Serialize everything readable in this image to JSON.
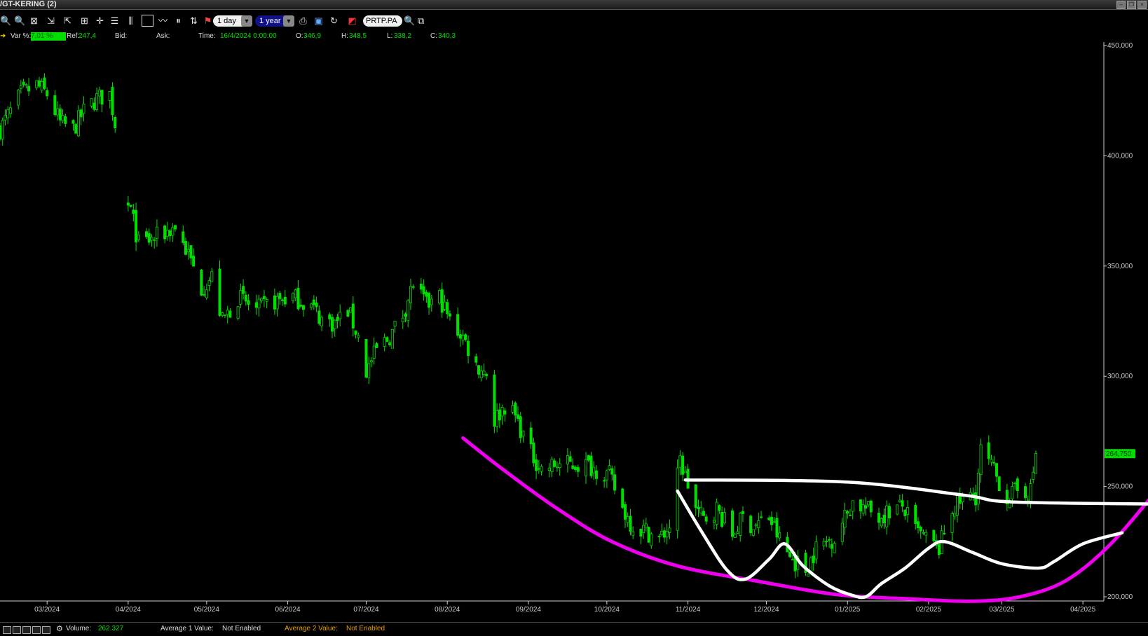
{
  "window": {
    "title": "/GT-KERING (2)"
  },
  "toolbar": {
    "interval": "1 day",
    "range": "1 year",
    "symbol": "PRTP.PA",
    "icons": [
      "zoom-in-icon",
      "zoom-out-icon",
      "zoom-fit-icon",
      "zoom-x-in-icon",
      "zoom-x-out-icon",
      "zoom-all-icon",
      "crosshair-icon",
      "list-icon",
      "bars-icon",
      "window-icon",
      "line-chart-icon",
      "candles-icon",
      "signals-icon",
      "flag-icon",
      "print-icon",
      "save-icon",
      "refresh-icon",
      "color-icon",
      "search-icon",
      "windows-icon"
    ]
  },
  "quote": {
    "var_label": "Var %:",
    "var_value": "7,01 %",
    "ref_label": "Ref:",
    "ref_value": "247,4",
    "bid_label": "Bid:",
    "ask_label": "Ask:",
    "time_label": "Time:",
    "time_value": "16/4/2024 0:00:00",
    "open_label": "O:",
    "open_value": "346,9",
    "high_label": "H:",
    "high_value": "348,5",
    "low_label": "L:",
    "low_value": "338,2",
    "close_label": "C:",
    "close_value": "340,3"
  },
  "status": {
    "volume_label": "Volume:",
    "volume_value": "262.327",
    "avg1_label": "Average 1 Value:",
    "avg1_value": "Not Enabled",
    "avg2_label": "Average 2 Value:",
    "avg2_value": "Not Enabled"
  },
  "colors": {
    "up": "#00e000",
    "background": "#000000",
    "magenta": "#ee00ee",
    "annotation": "#ffffff",
    "avg2": "#e6a000"
  },
  "chart_data": {
    "type": "candlestick",
    "x_start": "2024-02-12",
    "x_end": "2025-04-09",
    "x_ticks": [
      "03/2024",
      "04/2024",
      "05/2024",
      "06/2024",
      "07/2024",
      "08/2024",
      "09/2024",
      "10/2024",
      "11/2024",
      "12/2024",
      "01/2025",
      "02/2025",
      "03/2025",
      "04/2025"
    ],
    "x_tick_dates": [
      "2024-03-01",
      "2024-04-01",
      "2024-05-01",
      "2024-06-01",
      "2024-07-01",
      "2024-08-01",
      "2024-09-01",
      "2024-10-01",
      "2024-11-01",
      "2024-12-01",
      "2025-01-01",
      "2025-02-01",
      "2025-03-01",
      "2025-04-01"
    ],
    "y_ticks": [
      "200,000",
      "250,000",
      "300,000",
      "350,000",
      "400,000",
      "450,000"
    ],
    "ylim": [
      200,
      450
    ],
    "last_price_label": "264,750",
    "last_price": 264.75,
    "price_path": [
      [
        "2024-02-12",
        412
      ],
      [
        "2024-02-16",
        420
      ],
      [
        "2024-02-20",
        428
      ],
      [
        "2024-02-26",
        432
      ],
      [
        "2024-03-01",
        428
      ],
      [
        "2024-03-06",
        415
      ],
      [
        "2024-03-11",
        412
      ],
      [
        "2024-03-15",
        420
      ],
      [
        "2024-03-20",
        426
      ],
      [
        "2024-03-25",
        428
      ],
      [
        "2024-04-02",
        375
      ],
      [
        "2024-04-05",
        360
      ],
      [
        "2024-04-10",
        362
      ],
      [
        "2024-04-15",
        365
      ],
      [
        "2024-04-19",
        368
      ],
      [
        "2024-04-24",
        355
      ],
      [
        "2024-04-29",
        340
      ],
      [
        "2024-05-03",
        345
      ],
      [
        "2024-05-07",
        325
      ],
      [
        "2024-05-13",
        336
      ],
      [
        "2024-05-20",
        330
      ],
      [
        "2024-05-27",
        334
      ],
      [
        "2024-06-03",
        336
      ],
      [
        "2024-06-10",
        332
      ],
      [
        "2024-06-14",
        326
      ],
      [
        "2024-06-19",
        324
      ],
      [
        "2024-06-24",
        330
      ],
      [
        "2024-06-28",
        318
      ],
      [
        "2024-07-01",
        302
      ],
      [
        "2024-07-05",
        312
      ],
      [
        "2024-07-10",
        318
      ],
      [
        "2024-07-15",
        328
      ],
      [
        "2024-07-19",
        342
      ],
      [
        "2024-07-24",
        332
      ],
      [
        "2024-07-29",
        336
      ],
      [
        "2024-08-02",
        325
      ],
      [
        "2024-08-07",
        318
      ],
      [
        "2024-08-12",
        305
      ],
      [
        "2024-08-16",
        302
      ],
      [
        "2024-08-19",
        280
      ],
      [
        "2024-08-23",
        287
      ],
      [
        "2024-08-27",
        282
      ],
      [
        "2024-09-02",
        265
      ],
      [
        "2024-09-06",
        258
      ],
      [
        "2024-09-12",
        260
      ],
      [
        "2024-09-18",
        260
      ],
      [
        "2024-09-23",
        260
      ],
      [
        "2024-09-27",
        258
      ],
      [
        "2024-10-02",
        255
      ],
      [
        "2024-10-07",
        240
      ],
      [
        "2024-10-11",
        232
      ],
      [
        "2024-10-16",
        230
      ],
      [
        "2024-10-21",
        226
      ],
      [
        "2024-10-25",
        232
      ],
      [
        "2024-10-29",
        262
      ],
      [
        "2024-11-04",
        240
      ],
      [
        "2024-11-07",
        235
      ],
      [
        "2024-11-12",
        240
      ],
      [
        "2024-11-18",
        228
      ],
      [
        "2024-11-22",
        236
      ],
      [
        "2024-11-26",
        232
      ],
      [
        "2024-12-02",
        236
      ],
      [
        "2024-12-06",
        226
      ],
      [
        "2024-12-10",
        218
      ],
      [
        "2024-12-16",
        212
      ],
      [
        "2024-12-20",
        222
      ],
      [
        "2024-12-27",
        227
      ],
      [
        "2025-01-03",
        243
      ],
      [
        "2025-01-08",
        240
      ],
      [
        "2025-01-13",
        236
      ],
      [
        "2025-01-17",
        239
      ],
      [
        "2025-01-22",
        241
      ],
      [
        "2025-01-27",
        230
      ],
      [
        "2025-01-31",
        226
      ],
      [
        "2025-02-05",
        222
      ],
      [
        "2025-02-10",
        240
      ],
      [
        "2025-02-14",
        244
      ],
      [
        "2025-02-19",
        246
      ],
      [
        "2025-02-21",
        266
      ],
      [
        "2025-02-25",
        259
      ],
      [
        "2025-03-03",
        245
      ],
      [
        "2025-03-07",
        248
      ],
      [
        "2025-03-12",
        248
      ],
      [
        "2025-03-14",
        265
      ]
    ],
    "annotations": {
      "magenta_bowl": [
        [
          "2024-08-07",
          272
        ],
        [
          "2024-08-22",
          258
        ],
        [
          "2024-09-12",
          240
        ],
        [
          "2024-10-03",
          225
        ],
        [
          "2024-10-28",
          214
        ],
        [
          "2024-11-28",
          207
        ],
        [
          "2024-12-28",
          201
        ],
        [
          "2025-01-25",
          199
        ],
        [
          "2025-02-18",
          198
        ],
        [
          "2025-03-08",
          200
        ],
        [
          "2025-03-25",
          207
        ],
        [
          "2025-04-10",
          222
        ],
        [
          "2025-04-27",
          245
        ],
        [
          "2025-05-11",
          266
        ]
      ],
      "white_resistance": [
        [
          "2024-10-31",
          253
        ],
        [
          "2025-01-01",
          252
        ],
        [
          "2025-02-15",
          246
        ],
        [
          "2025-03-05",
          243
        ],
        [
          "2025-05-04",
          242
        ]
      ],
      "white_pattern": [
        [
          "2024-10-28",
          248
        ],
        [
          "2024-11-06",
          230
        ],
        [
          "2024-11-16",
          212
        ],
        [
          "2024-11-23",
          208
        ],
        [
          "2024-12-02",
          217
        ],
        [
          "2024-12-08",
          224
        ],
        [
          "2024-12-15",
          214
        ],
        [
          "2024-12-25",
          205
        ],
        [
          "2025-01-02",
          201
        ],
        [
          "2025-01-08",
          200
        ],
        [
          "2025-01-14",
          206
        ],
        [
          "2025-01-23",
          213
        ],
        [
          "2025-02-01",
          222
        ],
        [
          "2025-02-07",
          225
        ],
        [
          "2025-02-18",
          220
        ],
        [
          "2025-03-01",
          215
        ],
        [
          "2025-03-15",
          213
        ],
        [
          "2025-03-21",
          216
        ],
        [
          "2025-04-01",
          224
        ],
        [
          "2025-04-16",
          229
        ]
      ]
    }
  }
}
